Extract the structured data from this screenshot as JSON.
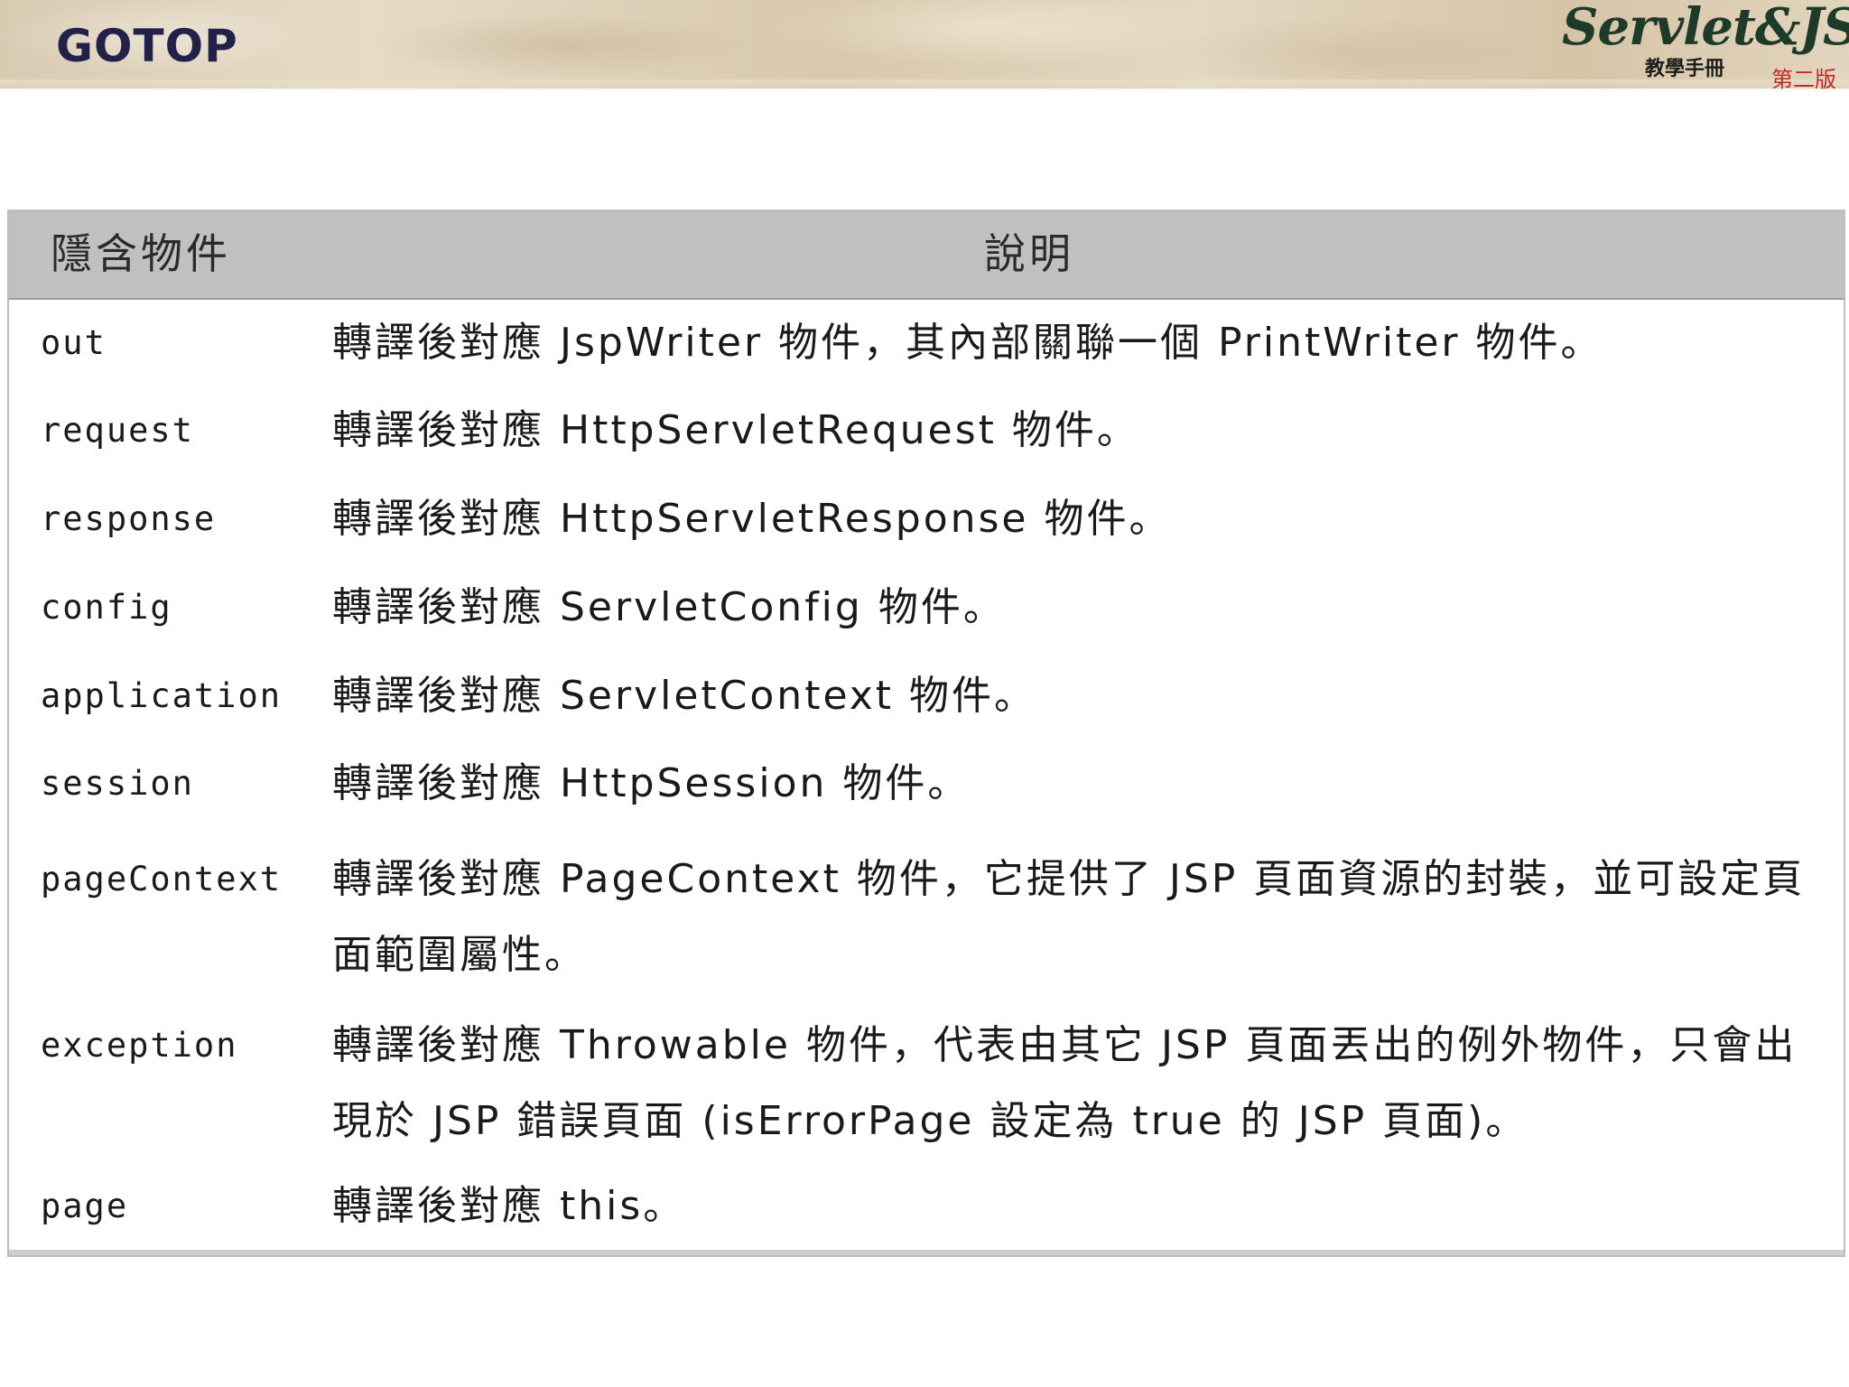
{
  "header": {
    "logo_left": "GOTOP",
    "logo_right": {
      "main": "Servlet&JSP",
      "sub": "教學手冊",
      "edition": "第二版"
    }
  },
  "table": {
    "columns": [
      "隱含物件",
      "說明"
    ],
    "rows": [
      {
        "name": "out",
        "desc": "轉譯後對應 JspWriter 物件，其內部關聯一個 PrintWriter 物件。"
      },
      {
        "name": "request",
        "desc": "轉譯後對應 HttpServletRequest 物件。"
      },
      {
        "name": "response",
        "desc": "轉譯後對應 HttpServletResponse 物件。"
      },
      {
        "name": "config",
        "desc": "轉譯後對應 ServletConfig 物件。"
      },
      {
        "name": "application",
        "desc": "轉譯後對應 ServletContext 物件。"
      },
      {
        "name": "session",
        "desc": "轉譯後對應 HttpSession 物件。"
      },
      {
        "name": "pageContext",
        "desc": "轉譯後對應 PageContext 物件，它提供了 JSP 頁面資源的封裝，並可設定頁面範圍屬性。"
      },
      {
        "name": "exception",
        "desc": "轉譯後對應 Throwable 物件，代表由其它 JSP 頁面丟出的例外物件，只會出現於 JSP 錯誤頁面 (isErrorPage 設定為 true 的 JSP 頁面)。"
      },
      {
        "name": "page",
        "desc": "轉譯後對應 this。"
      }
    ]
  }
}
